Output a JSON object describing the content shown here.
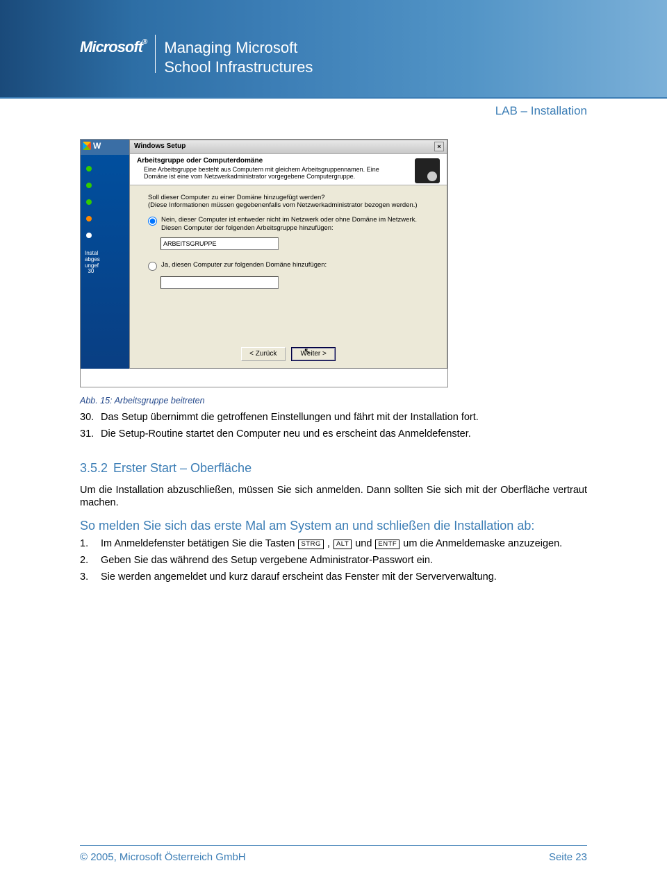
{
  "banner": {
    "brand": "Microsoft",
    "title_l1": "Managing Microsoft",
    "title_l2": "School Infrastructures"
  },
  "header_right": "LAB – Installation",
  "screenshot": {
    "side_title": "W",
    "side_status_l1": "Instal",
    "side_status_l2": "abges",
    "side_status_l3": "ungef",
    "side_status_l4": "30",
    "title": "Windows Setup",
    "head_title": "Arbeitsgruppe oder Computerdomäne",
    "head_sub": "Eine Arbeitsgruppe besteht aus Computern mit gleichem Arbeitsgruppennamen. Eine Domäne ist eine vom Netzwerkadministrator vorgegebene Computergruppe.",
    "question": "Soll dieser Computer zu einer Domäne hinzugefügt werden?\n(Diese Informationen müssen gegebenenfalls vom Netzwerkadministrator bezogen werden.)",
    "opt1": "Nein, dieser Computer ist entweder nicht im Netzwerk oder ohne Domäne im Netzwerk.\nDiesen Computer der folgenden Arbeitsgruppe hinzufügen:",
    "opt1_value": "ARBEITSGRUPPE",
    "opt2": "Ja, diesen Computer zur folgenden Domäne hinzufügen:",
    "opt2_value": "",
    "btn_back": "< Zurück",
    "btn_next": "Weiter >"
  },
  "caption": "Abb. 15: Arbeitsgruppe beitreten",
  "steps_a": [
    {
      "n": "30.",
      "t": "Das Setup übernimmt die getroffenen Einstellungen und fährt mit der Installation fort."
    },
    {
      "n": "31.",
      "t": "Die Setup-Routine startet den Computer neu und es erscheint das Anmeldefenster."
    }
  ],
  "section": {
    "num": "3.5.2",
    "title": "Erster Start – Oberfläche"
  },
  "intro": "Um die Installation abzuschließen, müssen Sie sich anmelden. Dann sollten Sie sich mit der Oberfläche vertraut machen.",
  "lead": "So melden Sie sich das erste Mal am System an und schließen die Installation ab:",
  "keys": {
    "strg": "STRG",
    "alt": "ALT",
    "entf": "ENTF"
  },
  "steps_b": [
    {
      "n": "1.",
      "pre": "Im Anmeldefenster betätigen Sie die Tasten ",
      "mid1": " , ",
      "mid2": "  und ",
      "post": "  um die Anmeldemaske anzuzeigen."
    },
    {
      "n": "2.",
      "t": "Geben Sie das während des Setup vergebene Administrator-Passwort ein."
    },
    {
      "n": "3.",
      "t": "Sie werden angemeldet und kurz darauf erscheint das Fenster mit der Serververwaltung."
    }
  ],
  "footer": {
    "left": "© 2005, Microsoft Österreich GmbH",
    "right": "Seite 23"
  }
}
